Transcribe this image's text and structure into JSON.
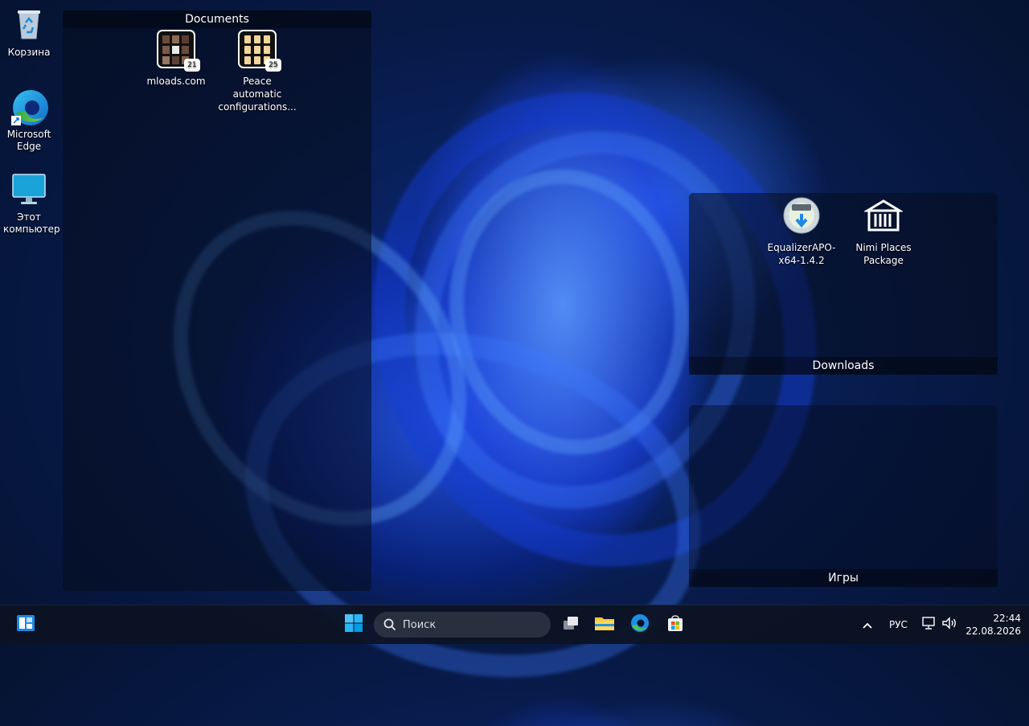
{
  "desktop_icons": [
    {
      "label": "Корзина",
      "icon": "recycle-bin-icon"
    },
    {
      "label": "Microsoft Edge",
      "icon": "edge-icon"
    },
    {
      "label": "Этот компьютер",
      "icon": "this-pc-icon"
    }
  ],
  "fences": {
    "documents": {
      "title": "Documents",
      "items": [
        {
          "label": "mloads.com",
          "count": "21"
        },
        {
          "label": "Peace automatic configurations...",
          "count": "25"
        }
      ]
    },
    "downloads": {
      "title": "Downloads",
      "items": [
        {
          "label": "EqualizerAPO-x64-1.4.2",
          "icon": "installer-disc-icon"
        },
        {
          "label": "Nimi Places Package",
          "icon": "package-icon"
        }
      ]
    },
    "games": {
      "title": "Игры"
    }
  },
  "taskbar": {
    "search_placeholder": "Поиск",
    "apps": [
      "widgets-icon",
      "start-icon",
      "task-view-icon",
      "file-explorer-icon",
      "edge-icon",
      "store-icon"
    ],
    "tray": {
      "language": "РУС",
      "time": "22:44",
      "date": "22.08.2026"
    }
  },
  "colors": {
    "accent": "#2b6cff",
    "taskbar_bg": "#0c1222"
  }
}
